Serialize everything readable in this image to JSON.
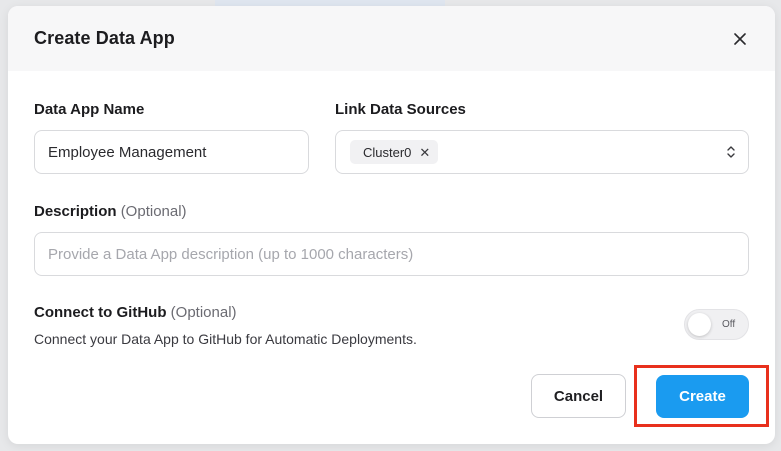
{
  "dialog": {
    "title": "Create Data App",
    "close_icon": "close-icon"
  },
  "fields": {
    "app_name": {
      "label": "Data App Name",
      "value": "Employee Management"
    },
    "data_sources": {
      "label": "Link Data Sources",
      "chips": [
        "Cluster0"
      ],
      "arrow_icon": "chevron-up-down-icon"
    },
    "description": {
      "label": "Description",
      "optional": "(Optional)",
      "placeholder": "Provide a Data App description (up to 1000 characters)",
      "value": ""
    },
    "github": {
      "label": "Connect to GitHub",
      "optional": "(Optional)",
      "description": "Connect your Data App to GitHub for Automatic Deployments.",
      "toggle_state": "Off"
    }
  },
  "actions": {
    "cancel_label": "Cancel",
    "create_label": "Create"
  },
  "colors": {
    "primary": "#1a9bf0",
    "highlight": "#e8301c"
  }
}
